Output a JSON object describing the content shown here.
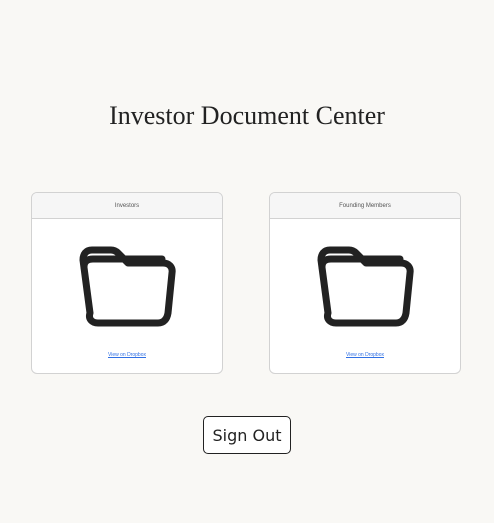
{
  "page": {
    "title": "Investor Document Center"
  },
  "cards": [
    {
      "header": "Investors",
      "icon": "folder-icon",
      "link_label": "View on Dropbox"
    },
    {
      "header": "Founding Members",
      "icon": "folder-icon",
      "link_label": "View on Dropbox"
    }
  ],
  "actions": {
    "sign_out_label": "Sign Out"
  },
  "colors": {
    "background": "#f9f8f5",
    "card_border": "#d2d2d2",
    "card_header_bg": "#f6f6f6",
    "link": "#2f6fe4",
    "icon": "#222222",
    "text": "#222222"
  }
}
